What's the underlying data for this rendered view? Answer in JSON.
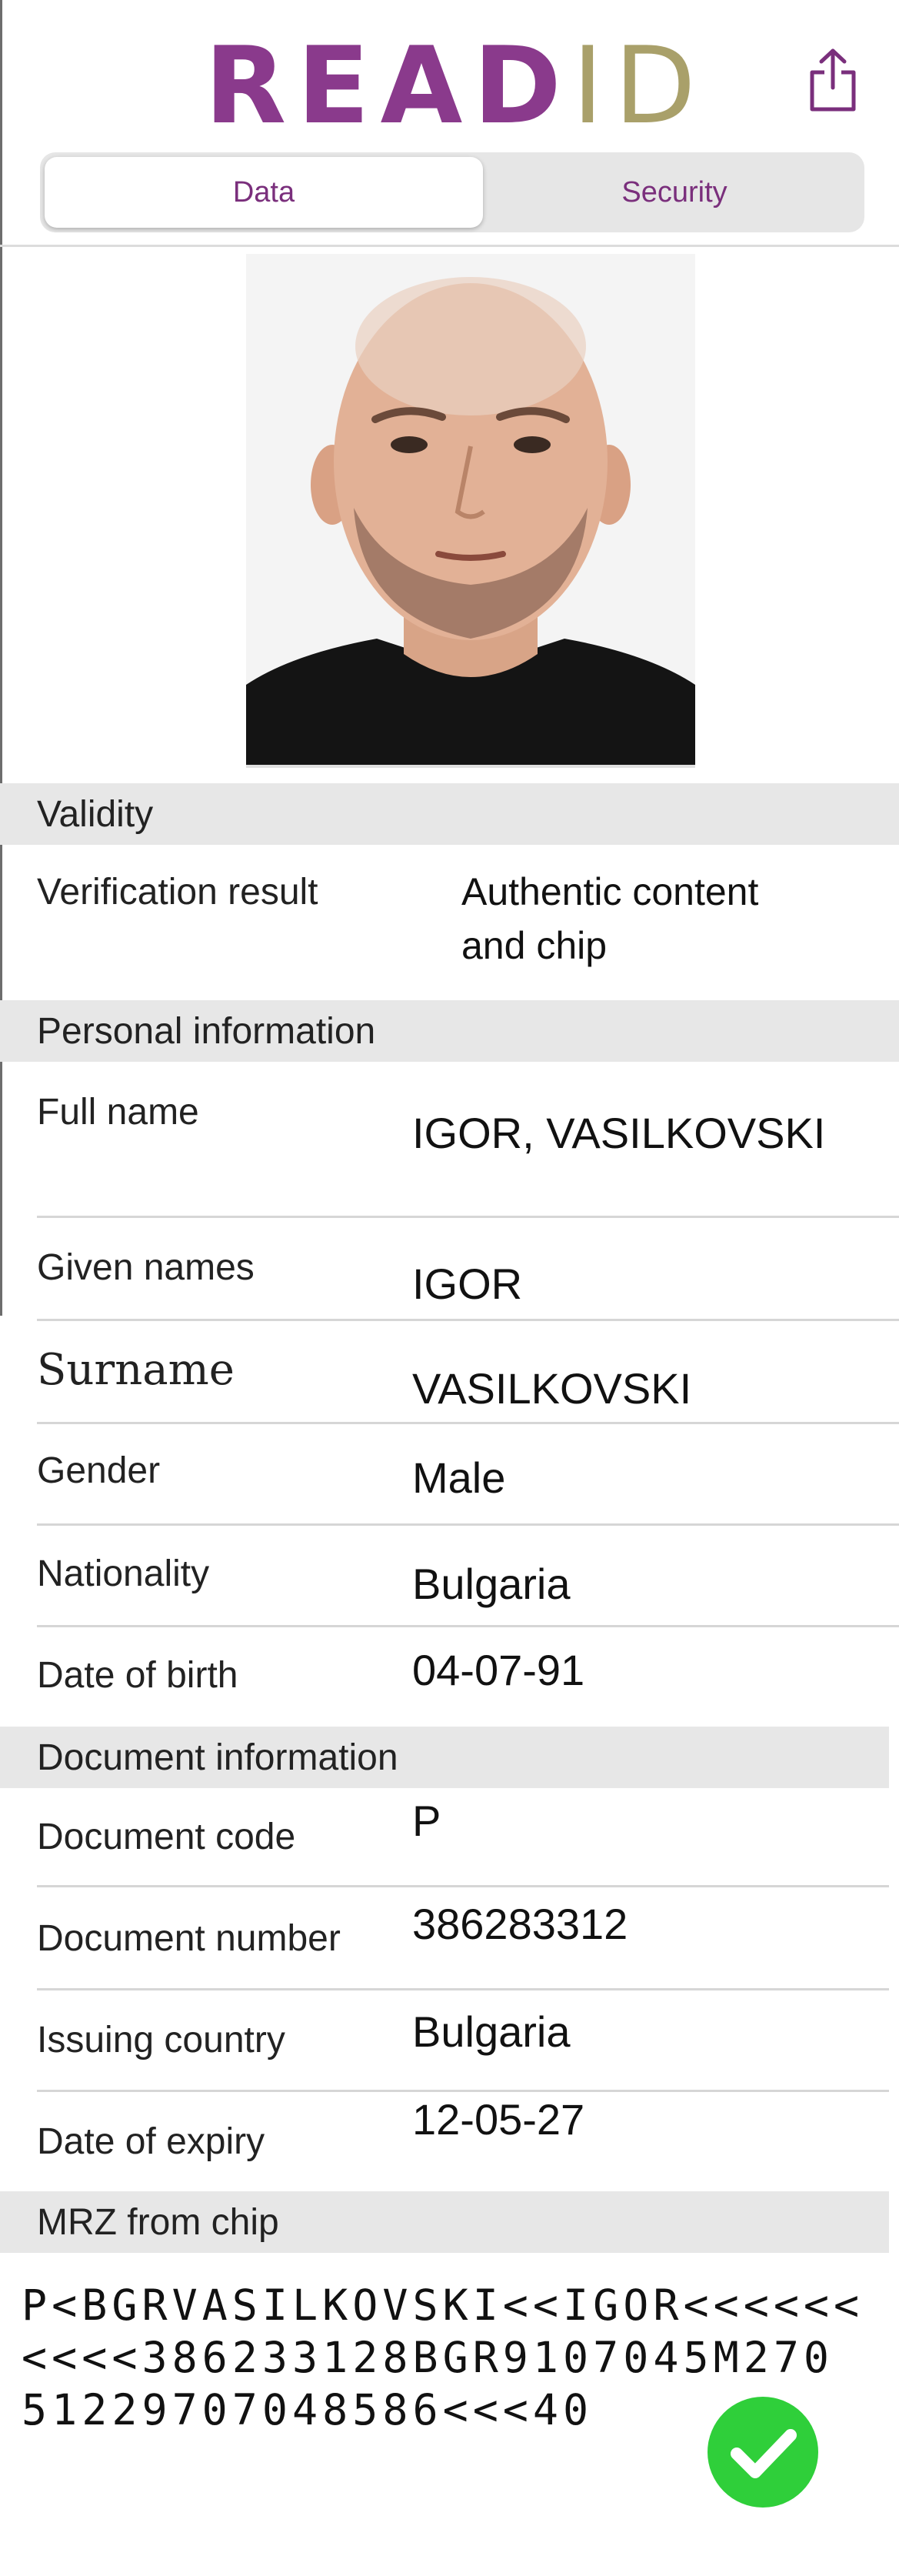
{
  "header": {
    "logo_read": "READ",
    "logo_id": "ID",
    "tabs": [
      {
        "label": "Data",
        "active": true
      },
      {
        "label": "Security",
        "active": false
      }
    ],
    "share_icon": "share-icon"
  },
  "photo": {
    "description": "portrait-photo"
  },
  "validity": {
    "title": "Validity",
    "verification_label": "Verification result",
    "verification_value_line1": "Authentic content",
    "verification_value_line2": "and chip"
  },
  "personal": {
    "title": "Personal information",
    "rows": [
      {
        "label": "Full name",
        "value": "IGOR, VASILKOVSKI"
      },
      {
        "label": "Given names",
        "value": "IGOR"
      },
      {
        "label": "Surname",
        "value": "VASILKOVSKI"
      },
      {
        "label": "Gender",
        "value": "Male"
      },
      {
        "label": "Nationality",
        "value": "Bulgaria"
      },
      {
        "label": "Date of birth",
        "value": "04-07-91"
      }
    ]
  },
  "document": {
    "title": "Document information",
    "rows": [
      {
        "label": "Document code",
        "value": "P"
      },
      {
        "label": "Document number",
        "value": "386283312"
      },
      {
        "label": "Issuing country",
        "value": "Bulgaria"
      },
      {
        "label": "Date of expiry",
        "value": "12-05-27"
      }
    ]
  },
  "mrz": {
    "title": "MRZ from chip",
    "lines": [
      "P<BGRVASILKOVSKI<<IGOR<<<<<<",
      "<<<<386233128BGR9107045M270",
      "51229707048586<<<40"
    ]
  },
  "status": {
    "icon": "checkmark-icon",
    "color": "#2fcf3a"
  },
  "colors": {
    "brand_purple": "#8a3a8c",
    "brand_gold": "#a9a06a"
  }
}
